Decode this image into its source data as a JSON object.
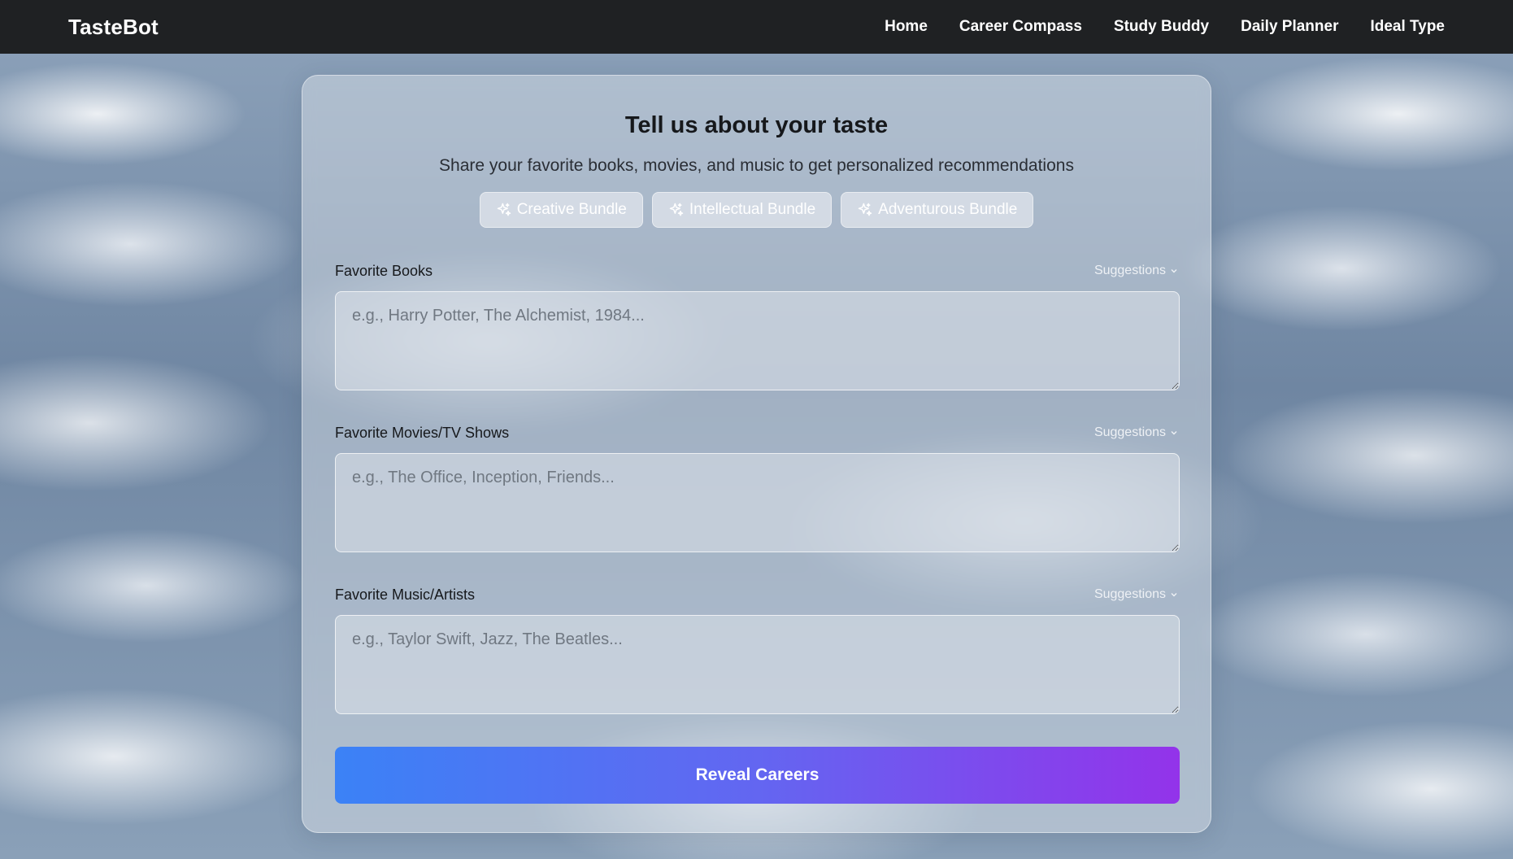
{
  "navbar": {
    "brand": "TasteBot",
    "links": [
      {
        "label": "Home"
      },
      {
        "label": "Career Compass"
      },
      {
        "label": "Study Buddy"
      },
      {
        "label": "Daily Planner"
      },
      {
        "label": "Ideal Type"
      }
    ]
  },
  "card": {
    "title": "Tell us about your taste",
    "subtitle": "Share your favorite books, movies, and music to get personalized recommendations",
    "bundles": [
      {
        "label": "Creative Bundle",
        "icon": "sparkle-icon"
      },
      {
        "label": "Intellectual Bundle",
        "icon": "sparkle-icon"
      },
      {
        "label": "Adventurous Bundle",
        "icon": "sparkle-icon"
      }
    ],
    "fields": [
      {
        "label": "Favorite Books",
        "suggestions": "Suggestions",
        "placeholder": "e.g., Harry Potter, The Alchemist, 1984...",
        "value": ""
      },
      {
        "label": "Favorite Movies/TV Shows",
        "suggestions": "Suggestions",
        "placeholder": "e.g., The Office, Inception, Friends...",
        "value": ""
      },
      {
        "label": "Favorite Music/Artists",
        "suggestions": "Suggestions",
        "placeholder": "e.g., Taylor Swift, Jazz, The Beatles...",
        "value": ""
      }
    ],
    "submit_label": "Reveal Careers"
  },
  "colors": {
    "navbar_bg": "#1f2123",
    "gradient_start": "#3b82f6",
    "gradient_end": "#9333ea"
  }
}
